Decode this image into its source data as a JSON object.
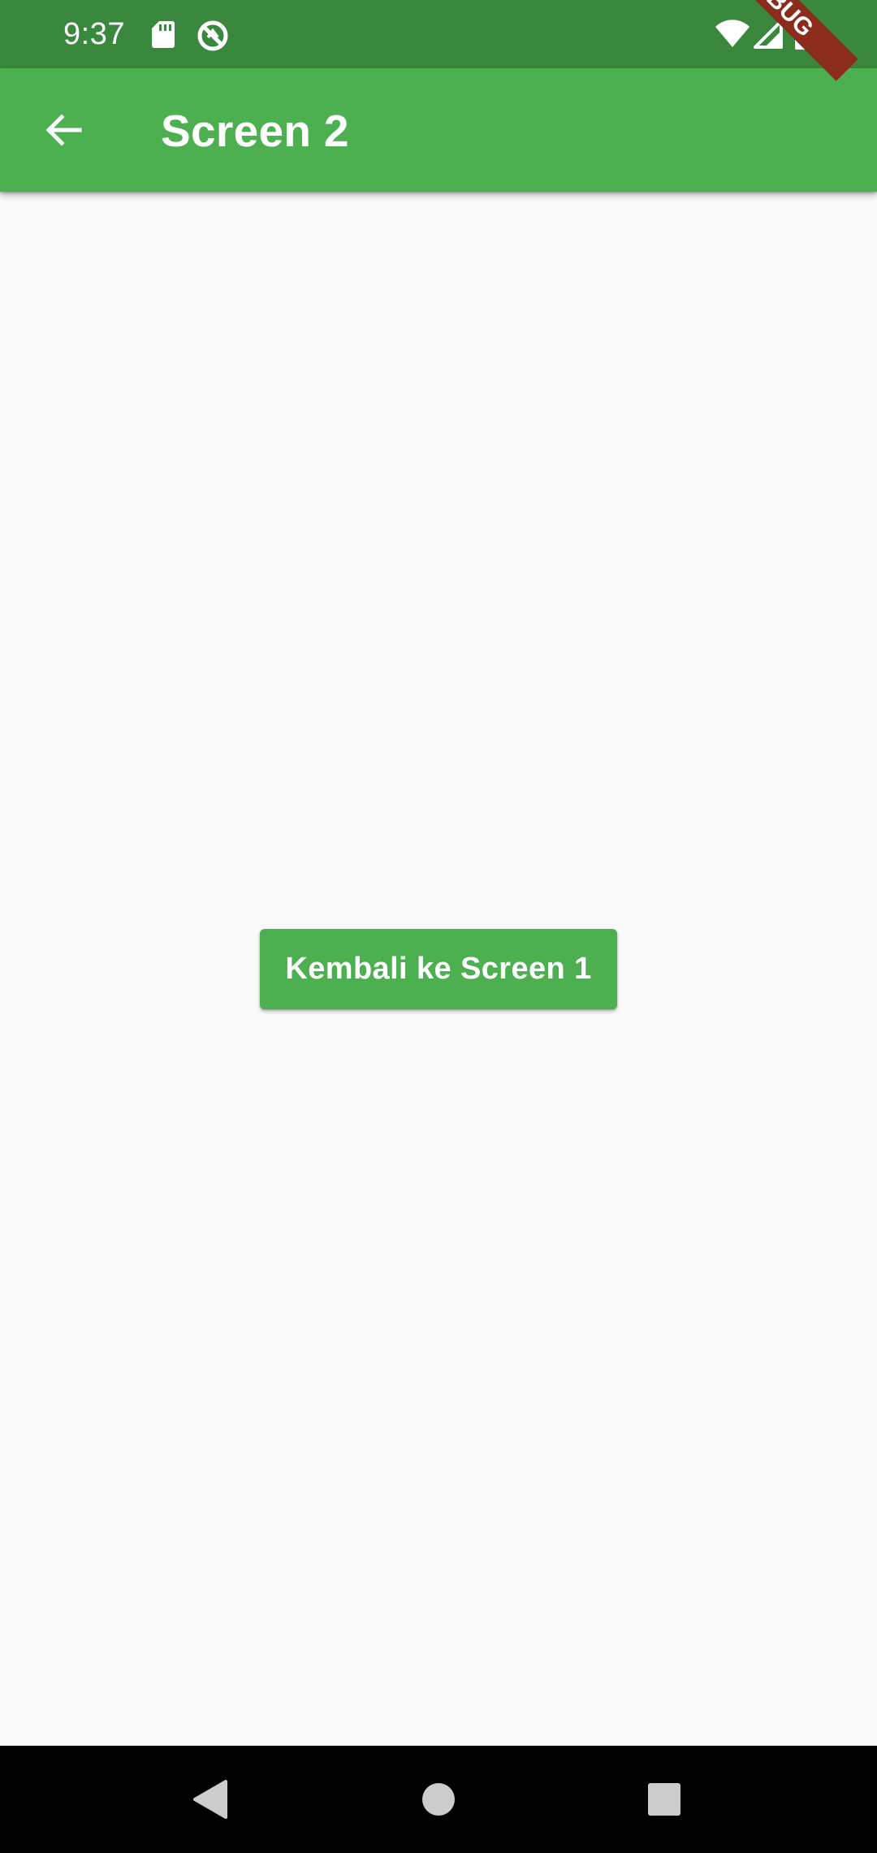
{
  "status_bar": {
    "time": "9:37",
    "icons": [
      "sd-card-icon",
      "sync-disabled-icon",
      "wifi-icon",
      "signal-icon",
      "battery-icon"
    ],
    "background": "#3a873e"
  },
  "app_bar": {
    "title": "Screen 2",
    "back_icon": "arrow-back-icon",
    "background": "#4caf50"
  },
  "debug_banner": {
    "label": "DEBUG",
    "color": "#8b2c1c"
  },
  "main": {
    "button_label": "Kembali ke Screen 1",
    "button_color": "#4caf50"
  },
  "nav_bar": {
    "icons": [
      "back-triangle-icon",
      "home-circle-icon",
      "recents-square-icon"
    ]
  }
}
